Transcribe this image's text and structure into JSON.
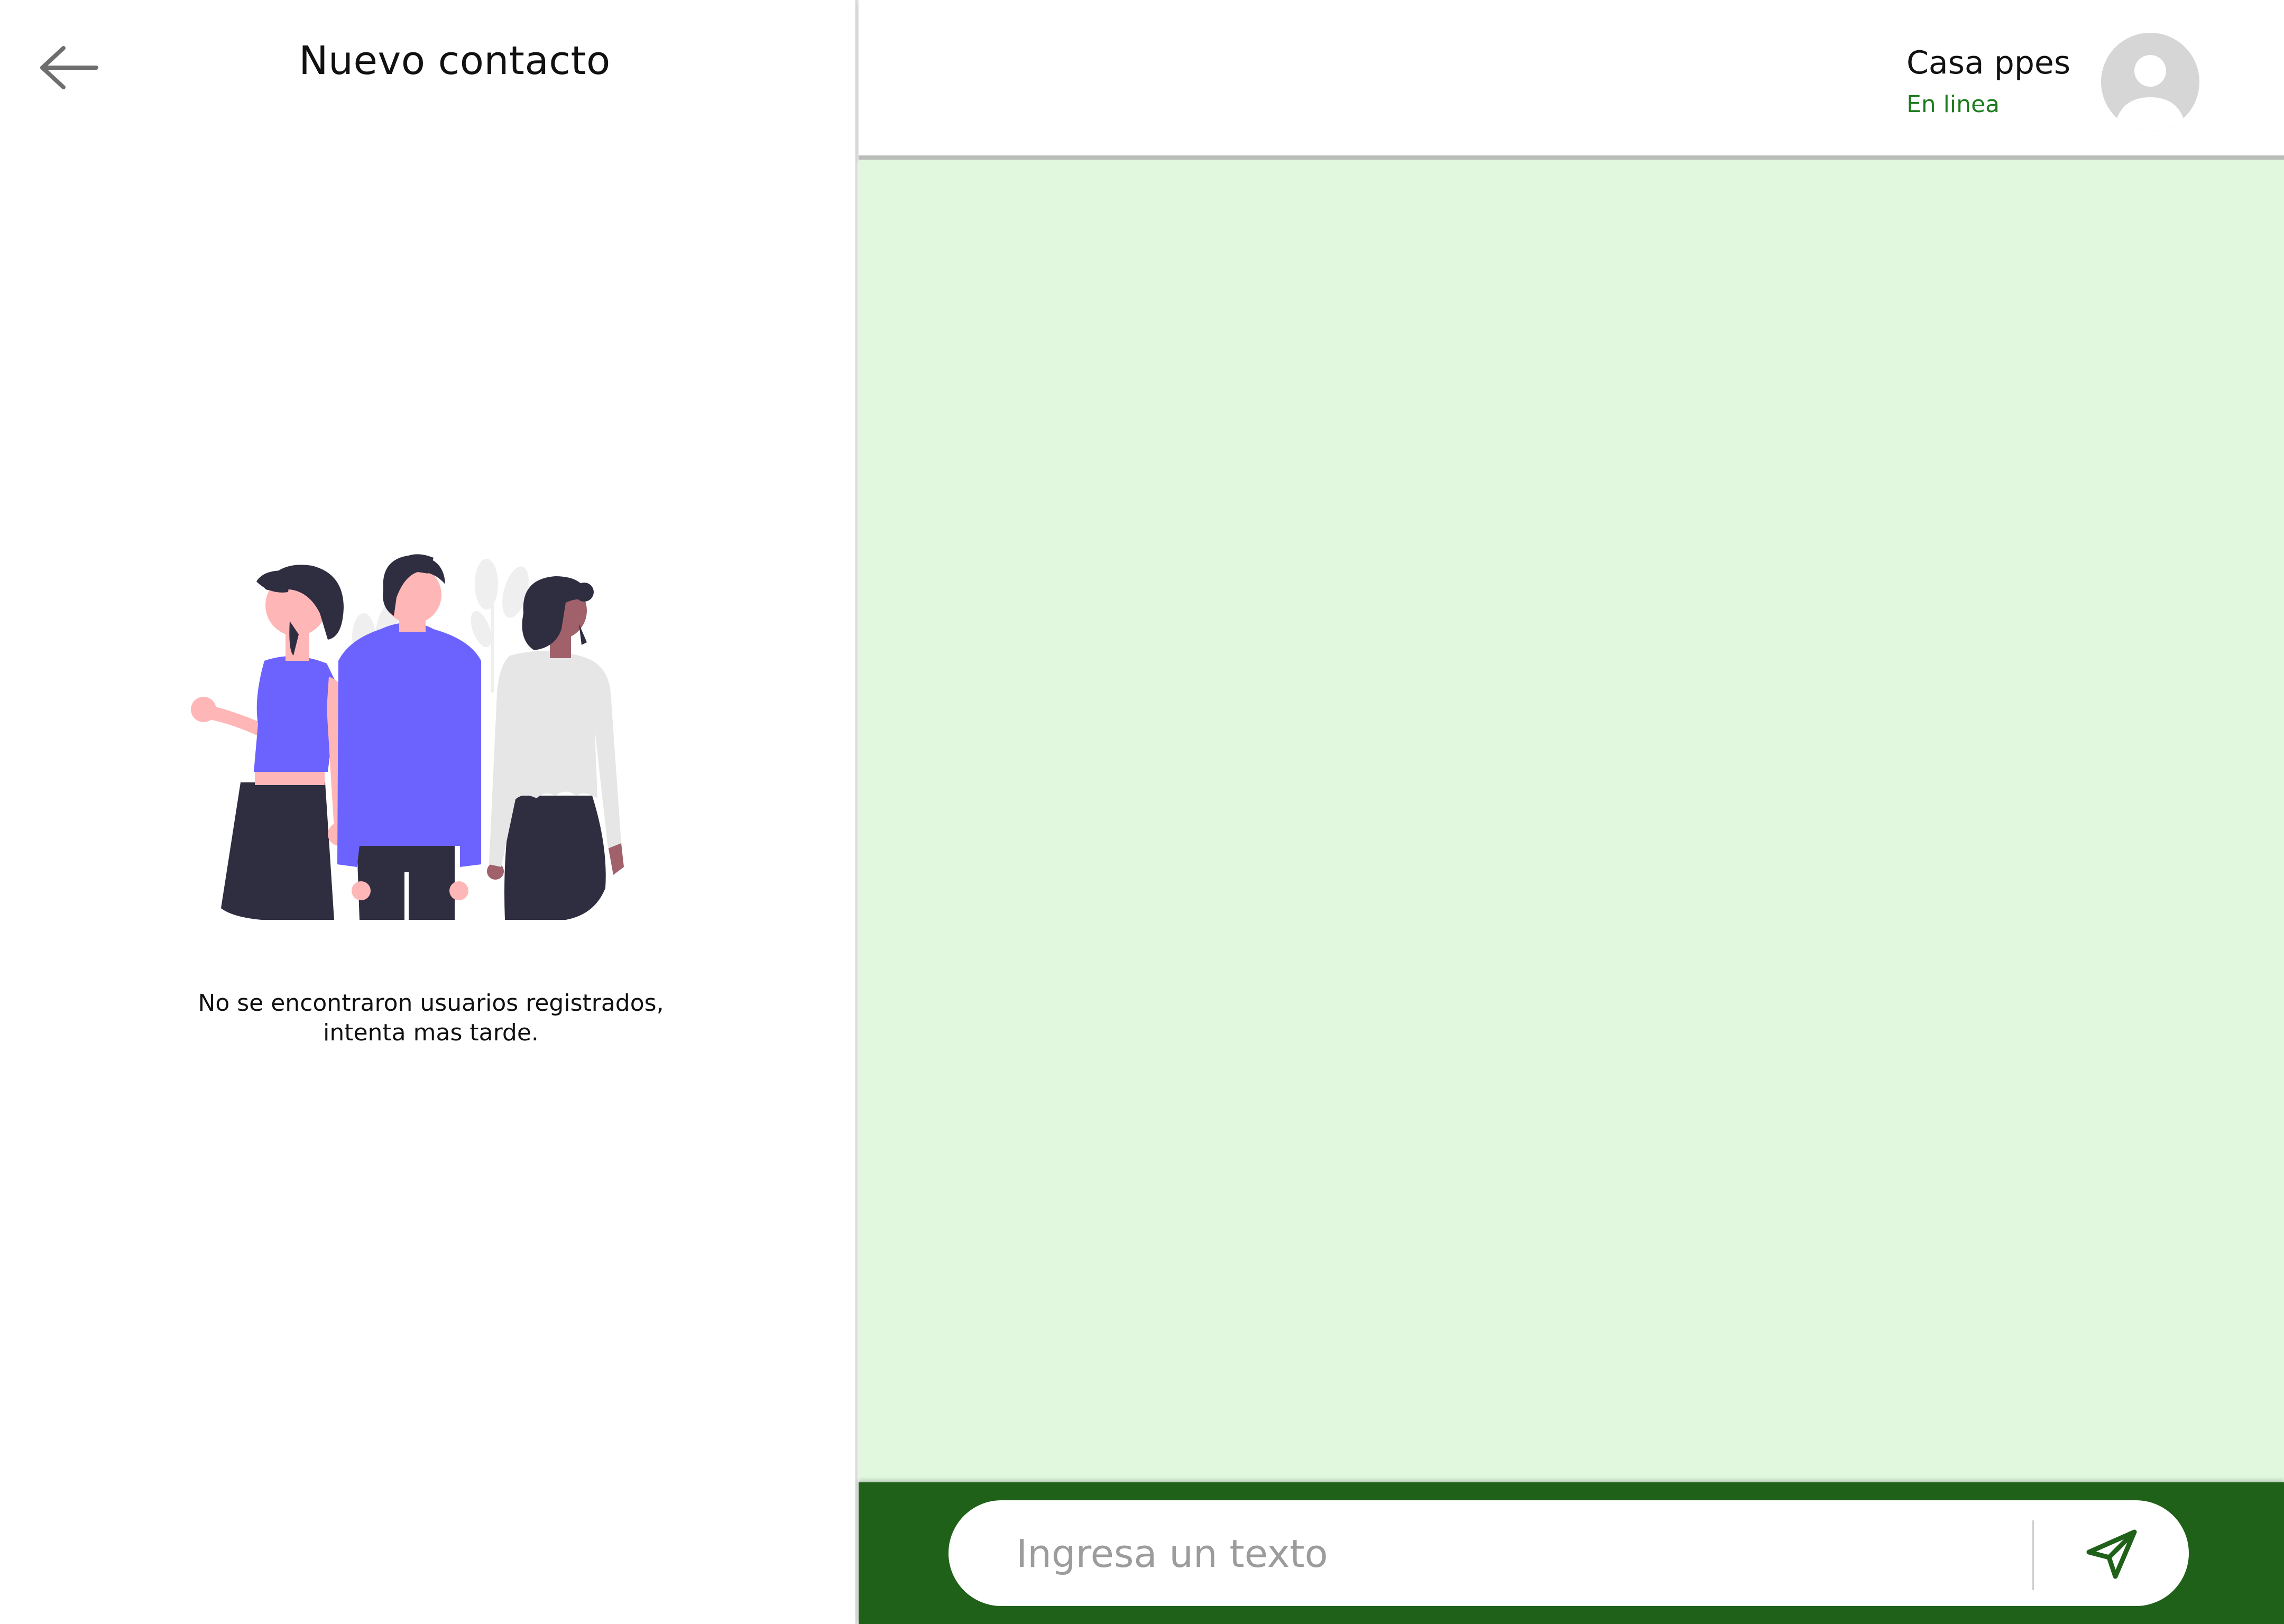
{
  "left_panel": {
    "title": "Nuevo contacto",
    "back_icon": "arrow-left-icon",
    "illustration": "people-group-illustration",
    "empty_message": {
      "line1": "No se encontraron usuarios registrados,",
      "line2": "intenta mas tarde."
    }
  },
  "chat": {
    "contact_name": "Casa ppes",
    "contact_status": "En linea",
    "avatar_icon": "user-placeholder-icon"
  },
  "composer": {
    "placeholder": "Ingresa un texto",
    "value": "",
    "send_icon": "send-icon"
  },
  "colors": {
    "chat_background": "#e1f8de",
    "footer_background": "#1f6119",
    "status_green": "#1e7b1e",
    "illustration_accent": "#6c63ff",
    "illustration_dark": "#2f2e41"
  }
}
